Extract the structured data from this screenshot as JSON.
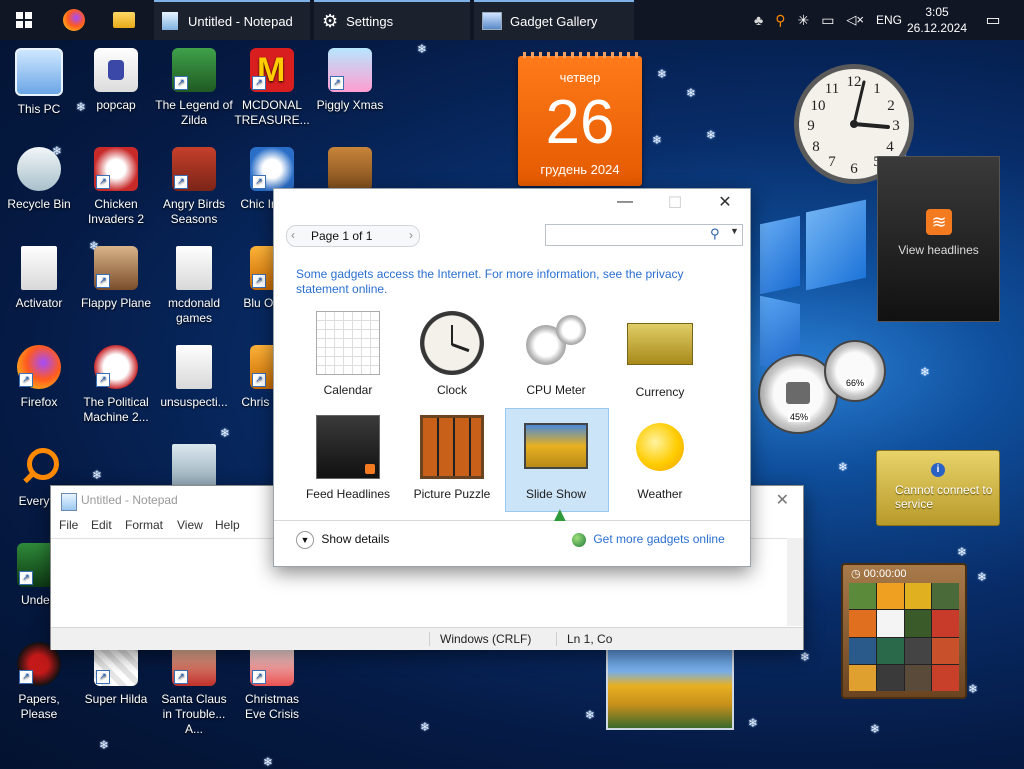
{
  "taskbar": {
    "apps": [
      {
        "label": "Untitled - Notepad"
      },
      {
        "label": "Settings"
      },
      {
        "label": "Gadget Gallery"
      }
    ],
    "tray": {
      "lang": "ENG",
      "time": "3:05",
      "date": "26.12.2024"
    }
  },
  "desktop_icons": [
    {
      "label": "This PC"
    },
    {
      "label": "popcap"
    },
    {
      "label": "The Legend of Zilda"
    },
    {
      "label": "MCDONAL TREASURE..."
    },
    {
      "label": "Piggly Xmas"
    },
    {
      "label": "Recycle Bin"
    },
    {
      "label": "Chicken Invaders 2"
    },
    {
      "label": "Angry Birds Seasons"
    },
    {
      "label": "Chic Invade"
    },
    {
      "label": "Activator"
    },
    {
      "label": "Flappy Plane"
    },
    {
      "label": "mcdonald games"
    },
    {
      "label": "Blu Ornam"
    },
    {
      "label": "Firefox"
    },
    {
      "label": "The Political Machine 2..."
    },
    {
      "label": "unsuspecti..."
    },
    {
      "label": "Chris Swee"
    },
    {
      "label": "Everyth"
    },
    {
      "label": "Undert"
    },
    {
      "label": "Papers, Please"
    },
    {
      "label": "Super Hilda"
    },
    {
      "label": "Santa Claus in Trouble... A..."
    },
    {
      "label": "Christmas Eve Crisis"
    }
  ],
  "calendar_gadget": {
    "weekday": "четвер",
    "day": "26",
    "month_year": "грудень 2024"
  },
  "rss_gadget": {
    "label": "View headlines"
  },
  "currency_gadget": {
    "label": "Cannot connect to service"
  },
  "puzzle_gadget": {
    "timer": "00:00:00"
  },
  "cpu_gadget": {
    "cpu": "45%",
    "mem": "66%"
  },
  "gadget_gallery": {
    "page": "Page 1 of 1",
    "search_placeholder": "",
    "notice": "Some gadgets access the Internet.  For more information, see the privacy statement online.",
    "items": [
      {
        "label": "Calendar"
      },
      {
        "label": "Clock"
      },
      {
        "label": "CPU Meter"
      },
      {
        "label": "Currency"
      },
      {
        "label": "Feed Headlines"
      },
      {
        "label": "Picture Puzzle"
      },
      {
        "label": "Slide Show"
      },
      {
        "label": "Weather"
      }
    ],
    "selected": "Slide Show",
    "show_details": "Show details",
    "get_more": "Get more gadgets online"
  },
  "notepad": {
    "title": "Untitled - Notepad",
    "menu": [
      "File",
      "Edit",
      "Format",
      "View",
      "Help"
    ],
    "status_encoding": "Windows (CRLF)",
    "status_pos": "Ln 1, Co"
  }
}
